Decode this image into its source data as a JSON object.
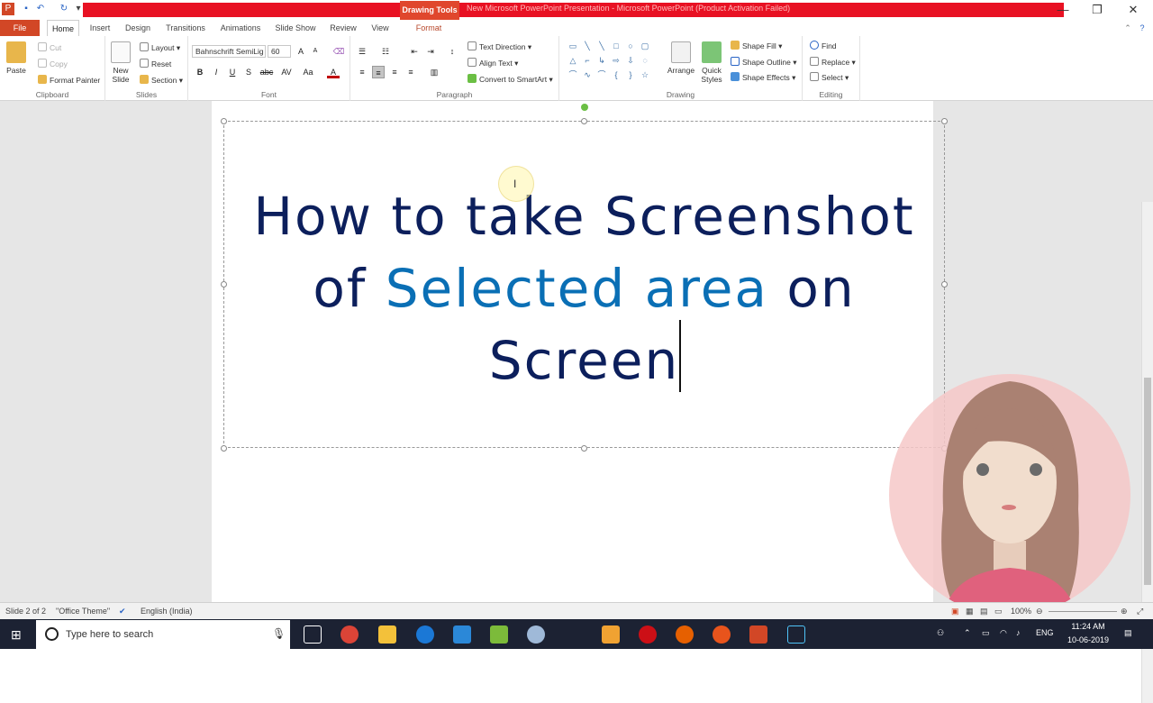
{
  "window": {
    "contextual_tab": "Drawing Tools",
    "title": "New Microsoft PowerPoint Presentation - Microsoft PowerPoint (Product Activation Failed)",
    "controls": {
      "minimize": "—",
      "restore": "❐",
      "close": "✕"
    }
  },
  "tabs": [
    "File",
    "Home",
    "Insert",
    "Design",
    "Transitions",
    "Animations",
    "Slide Show",
    "Review",
    "View",
    "Format"
  ],
  "ribbon": {
    "clipboard": {
      "label": "Clipboard",
      "paste": "Paste",
      "cut": "Cut",
      "copy": "Copy",
      "format_painter": "Format Painter"
    },
    "slides": {
      "label": "Slides",
      "new_slide_1": "New",
      "new_slide_2": "Slide",
      "layout": "Layout",
      "reset": "Reset",
      "section": "Section"
    },
    "font": {
      "label": "Font",
      "font_name": "Bahnschrift SemiLig",
      "font_size": "60",
      "bold": "B",
      "italic": "I",
      "underline": "U",
      "strike": "S",
      "abc": "abc",
      "av": "AV",
      "aa": "Aa",
      "fontcolor": "A",
      "grow": "A",
      "shrink": "A"
    },
    "paragraph": {
      "label": "Paragraph",
      "text_direction": "Text Direction",
      "align_text": "Align Text",
      "smartart": "Convert to SmartArt"
    },
    "drawing": {
      "label": "Drawing",
      "arrange": "Arrange",
      "quick_styles_1": "Quick",
      "quick_styles_2": "Styles",
      "shape_fill": "Shape Fill",
      "shape_outline": "Shape Outline",
      "shape_effects": "Shape Effects"
    },
    "editing": {
      "label": "Editing",
      "find": "Find",
      "replace": "Replace",
      "select": "Select"
    }
  },
  "slide": {
    "line1": "How to take Screenshot",
    "line2_a": "of ",
    "line2_b": "Selected area",
    "line2_c": " on",
    "line3": "Screen",
    "colors": {
      "main": "#0c1f5c",
      "highlight": "#0a6fb5"
    }
  },
  "status": {
    "slide": "Slide 2 of 2",
    "theme": "\"Office Theme\"",
    "language": "English (India)",
    "zoom": "100%"
  },
  "taskbar": {
    "search_placeholder": "Type here to search",
    "lang": "ENG",
    "time": "11:24 AM",
    "date": "10-06-2019"
  }
}
